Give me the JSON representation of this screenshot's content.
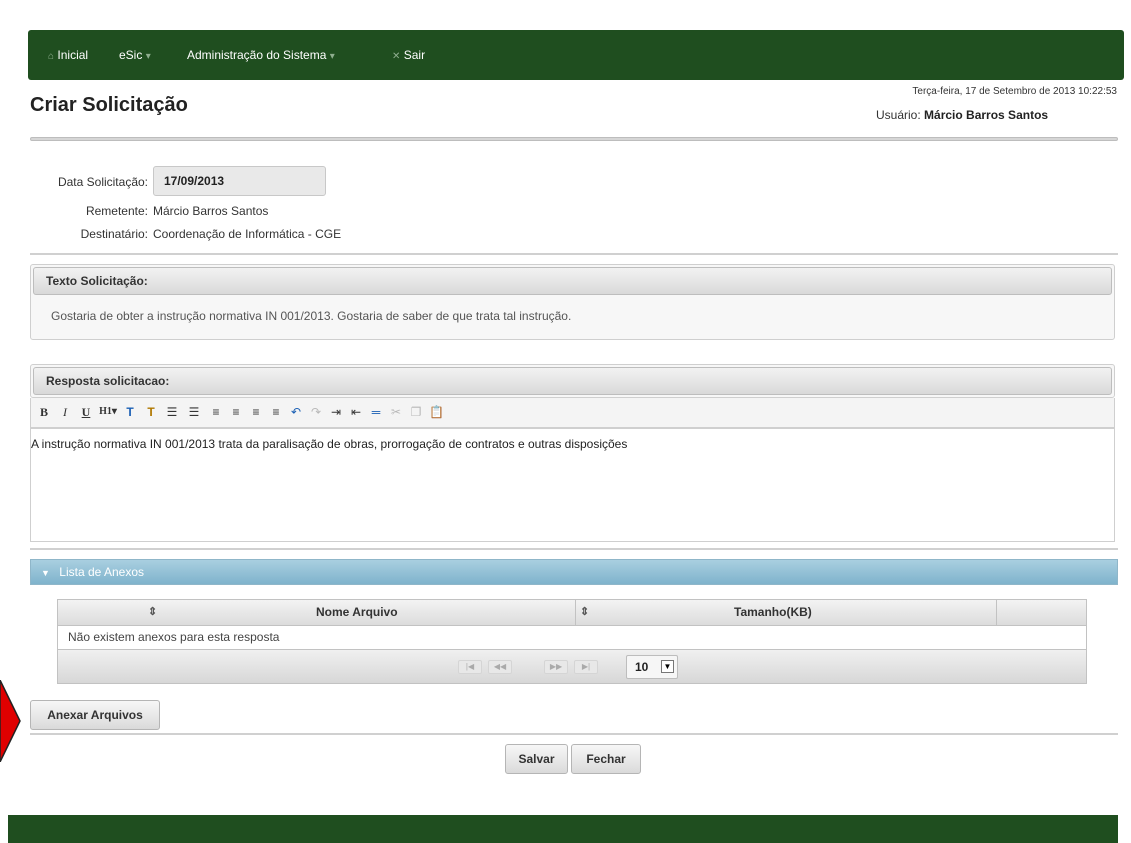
{
  "nav": {
    "home": "Inicial",
    "esic": "eSic",
    "admin": "Administração do Sistema",
    "logout": "Sair"
  },
  "header": {
    "title": "Criar Solicitação",
    "datetime": "Terça-feira, 17 de Setembro de 2013 10:22:53",
    "user_label": "Usuário:",
    "user_name": "Márcio Barros Santos"
  },
  "form": {
    "date_label": "Data Solicitação:",
    "date_value": "17/09/2013",
    "sender_label": "Remetente:",
    "sender_value": "Márcio Barros Santos",
    "recipient_label": "Destinatário:",
    "recipient_value": "Coordenação de Informática - CGE"
  },
  "request_text": {
    "header": "Texto Solicitação:",
    "body": "Gostaria de obter a instrução normativa IN 001/2013. Gostaria de saber de que trata tal instrução."
  },
  "response": {
    "header": "Resposta solicitacao:",
    "content": "A instrução normativa IN 001/2013 trata da paralisação de obras, prorrogação de contratos e outras disposições",
    "toolbar": [
      "bold-icon",
      "italic-icon",
      "underline-icon",
      "heading-icon",
      "font-color-icon",
      "clear-format-icon",
      "bullet-list-icon",
      "numbered-list-icon",
      "align-left-icon",
      "align-center-icon",
      "align-right-icon",
      "align-justify-icon",
      "undo-icon",
      "redo-icon",
      "indent-icon",
      "outdent-icon",
      "horizontal-rule-icon",
      "cut-icon",
      "copy-icon",
      "paste-icon"
    ]
  },
  "attachments": {
    "header": "Lista de Anexos",
    "columns": [
      "Nome Arquivo",
      "Tamanho(KB)"
    ],
    "empty_message": "Não existem anexos para esta resposta",
    "page_size": "10"
  },
  "buttons": {
    "attach": "Anexar Arquivos",
    "save": "Salvar",
    "close": "Fechar"
  },
  "colors": {
    "nav_bg": "#1f4e1f",
    "accordion_bg": "#8fbfd4",
    "marker": "#e00000"
  }
}
